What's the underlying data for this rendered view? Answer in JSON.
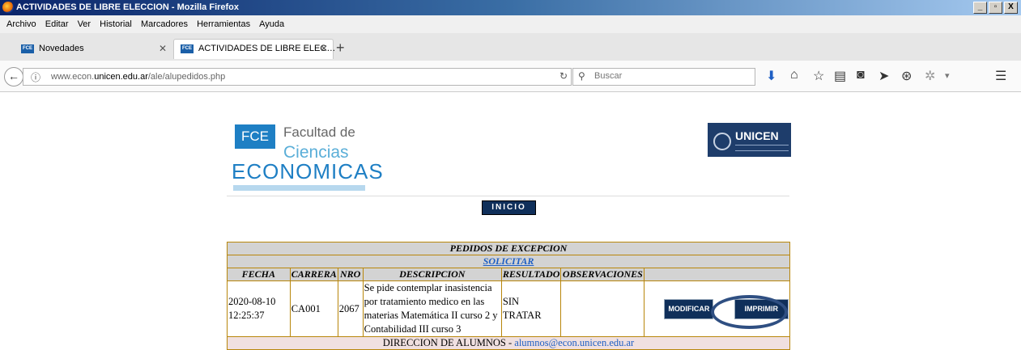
{
  "window": {
    "title": "ACTIVIDADES DE LIBRE ELECCION - Mozilla Firefox",
    "buttons": [
      "_",
      "▫",
      "X"
    ]
  },
  "menu": [
    "Archivo",
    "Editar",
    "Ver",
    "Historial",
    "Marcadores",
    "Herramientas",
    "Ayuda"
  ],
  "tabs": [
    {
      "label": "Novedades",
      "favicon": "FCE"
    },
    {
      "label": "ACTIVIDADES DE LIBRE ELEC…",
      "favicon": "FCE"
    }
  ],
  "nav": {
    "url_prefix": "www.econ.",
    "url_domain": "unicen.edu.ar",
    "url_path": "/ale/alupedidos.php",
    "search_placeholder": "Buscar"
  },
  "logo_fce": {
    "badge": "FCE",
    "line1": "Facultad de",
    "line2": "Ciencias",
    "line3": "ECONOMICAS"
  },
  "logo_unicen": {
    "name": "UNICEN"
  },
  "inicio_label": "INICIO",
  "table": {
    "title": "PEDIDOS DE EXCEPCION",
    "solicitar": "SOLICITAR",
    "headers": [
      "FECHA",
      "CARRERA",
      "NRO",
      "DESCRIPCION",
      "RESULTADO",
      "OBSERVACIONES"
    ],
    "row": {
      "fecha": "2020-08-10 12:25:37",
      "carrera": "CA001",
      "nro": "2067",
      "descripcion": "Se pide contemplar inasistencia por tratamiento medico en las materias Matemática II curso 2 y Contabilidad III curso 3",
      "resultado": "SIN TRATAR",
      "observaciones": "",
      "modificar": "MODIFICAR",
      "imprimir": "IMPRIMIR"
    },
    "footer_text": "DIRECCION DE ALUMNOS - ",
    "footer_email": "alumnos@econ.unicen.edu.ar"
  }
}
